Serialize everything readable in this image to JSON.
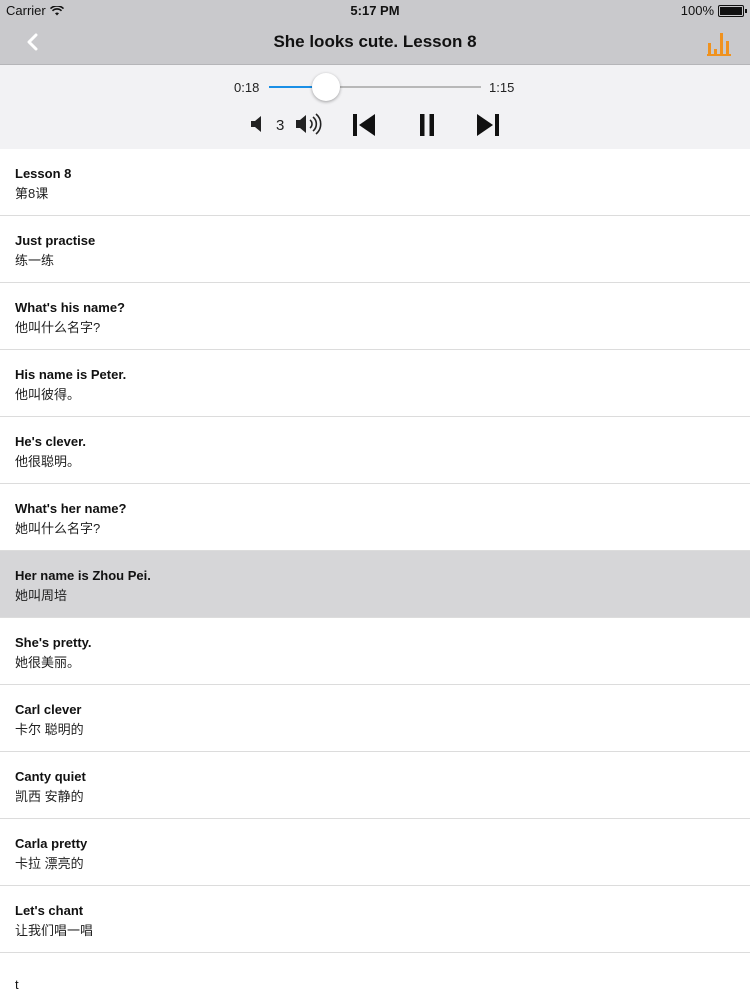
{
  "status_bar": {
    "carrier": "Carrier",
    "time": "5:17 PM",
    "battery": "100%",
    "battery_level": 1.0
  },
  "nav": {
    "title": "She looks cute. Lesson 8",
    "back_icon": "chevron-left-icon",
    "stats_icon": "bar-chart-icon",
    "accent_color": "#f0921e"
  },
  "player": {
    "current_time": "0:18",
    "total_time": "1:15",
    "progress": 0.27,
    "rate": "3",
    "progress_color": "#1a8fe6"
  },
  "lines": [
    {
      "en": "Lesson 8",
      "zh": "第8课"
    },
    {
      "en": "Just practise",
      "zh": "练一练"
    },
    {
      "en": "What's his name?",
      "zh": "他叫什么名字?"
    },
    {
      "en": "His name is Peter.",
      "zh": "他叫彼得。"
    },
    {
      "en": "He's clever.",
      "zh": "他很聪明。"
    },
    {
      "en": "What's her name?",
      "zh": "她叫什么名字?"
    },
    {
      "en": "Her name is Zhou Pei.",
      "zh": "她叫周培"
    },
    {
      "en": "She's pretty.",
      "zh": "她很美丽。"
    },
    {
      "en": "Carl clever",
      "zh": "卡尔 聪明的"
    },
    {
      "en": "Canty quiet",
      "zh": "凯西 安静的"
    },
    {
      "en": "Carla pretty",
      "zh": "卡拉 漂亮的"
    },
    {
      "en": "Let's chant",
      "zh": "让我们唱一唱"
    }
  ],
  "active_index": 6,
  "last_line": "t"
}
